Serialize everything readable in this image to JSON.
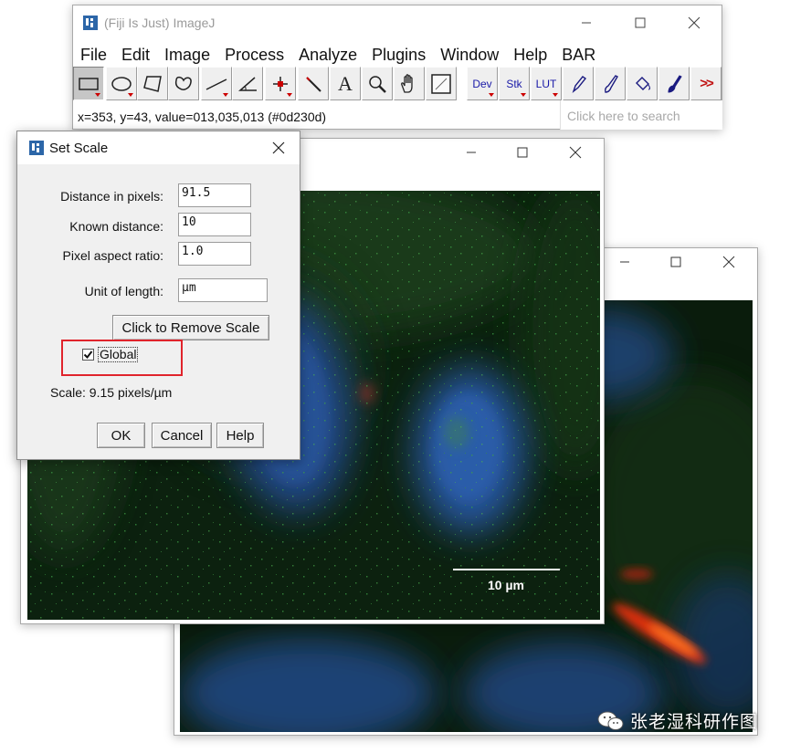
{
  "imagej": {
    "title": "(Fiji Is Just) ImageJ",
    "menus": [
      "File",
      "Edit",
      "Image",
      "Process",
      "Analyze",
      "Plugins",
      "Window",
      "Help",
      "BAR"
    ],
    "tools": {
      "dev": "Dev",
      "stk": "Stk",
      "lut": "LUT",
      "text_tool": "A",
      "more": ">>"
    },
    "status": "x=353, y=43, value=013,035,013 (#0d230d)",
    "search_placeholder": "Click here to search"
  },
  "dialog": {
    "title": "Set Scale",
    "fields": [
      {
        "label": "Distance in pixels:",
        "value": "91.5"
      },
      {
        "label": "Known distance:",
        "value": "10"
      },
      {
        "label": "Pixel aspect ratio:",
        "value": "1.0"
      },
      {
        "label": "Unit of length:",
        "value": "µm"
      }
    ],
    "remove_scale_label": "Click to Remove Scale",
    "global_label": "Global",
    "global_checked": true,
    "scale_text": "Scale: 9.15 pixels/µm",
    "ok_label": "OK",
    "cancel_label": "Cancel",
    "help_label": "Help"
  },
  "image": {
    "scale_bar_label": "10 µm"
  },
  "watermark": "张老湿科研作图",
  "colors": {
    "highlight": "#e0242c",
    "tool_text": "#1a1aa8",
    "dropdown_marker": "#cc0000"
  }
}
